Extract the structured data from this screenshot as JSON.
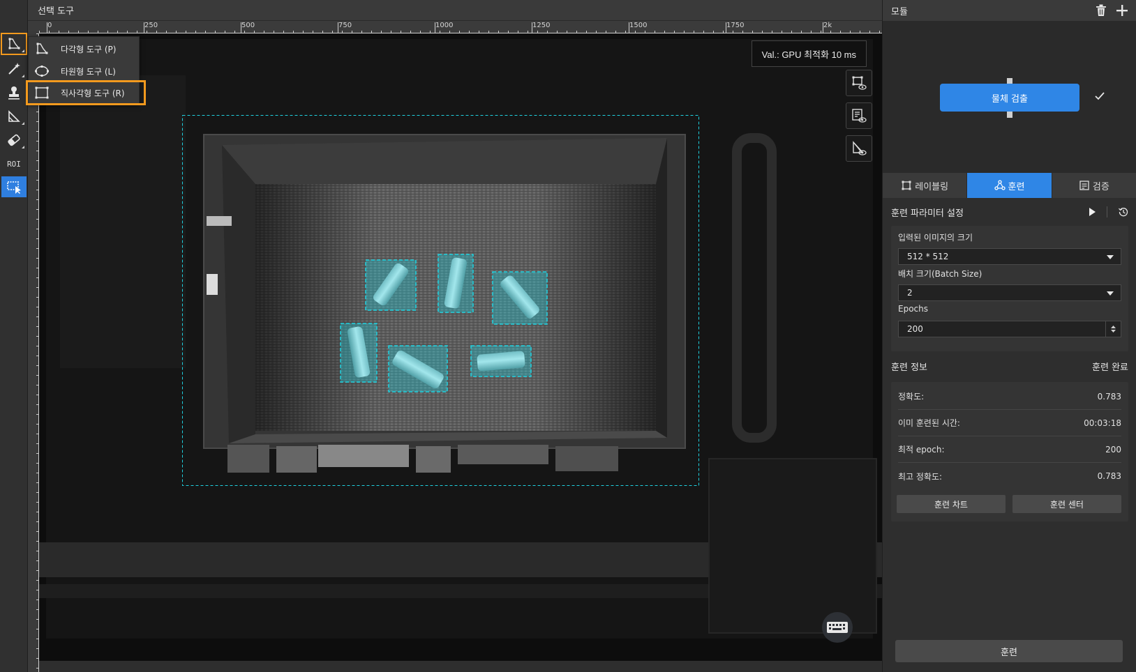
{
  "title_bar": {
    "title": "선택 도구"
  },
  "ruler": {
    "ticks": [
      "0",
      "250",
      "500",
      "750",
      "1000",
      "1250",
      "1500",
      "1750",
      "2k"
    ]
  },
  "toolbar": {
    "tools": [
      {
        "name": "polygon-tool",
        "icon": "polygon-icon",
        "highlighted": true
      },
      {
        "name": "magic-wand-tool",
        "icon": "magic-wand-icon"
      },
      {
        "name": "stamp-tool",
        "icon": "stamp-icon"
      },
      {
        "name": "polygon-eraser-tool",
        "icon": "polygon-corner-icon"
      },
      {
        "name": "eraser-tool",
        "icon": "eraser-icon"
      },
      {
        "name": "roi-tool",
        "icon": "roi-icon",
        "label": "ROI"
      },
      {
        "name": "select-tool",
        "icon": "select-rect-icon",
        "active": true
      }
    ]
  },
  "flyout": {
    "items": [
      {
        "label": "다각형 도구 (P)",
        "icon": "polygon-icon"
      },
      {
        "label": "타원형 도구 (L)",
        "icon": "ellipse-icon"
      },
      {
        "label": "직사각형 도구 (R)",
        "icon": "rectangle-icon",
        "highlighted": true
      }
    ]
  },
  "canvas": {
    "val_badge": "Val.:  GPU 최적화 10 ms",
    "view_buttons": [
      "label-view-icon",
      "list-view-icon",
      "mask-view-icon"
    ],
    "keyboard_icon": "keyboard-icon"
  },
  "right_panel": {
    "module_header": {
      "title": "모듈",
      "icons": [
        "trash-icon",
        "plus-icon"
      ]
    },
    "module_node": {
      "label": "물체 검출",
      "status_icon": "check-icon"
    },
    "tabs": [
      {
        "label": "레이블링",
        "icon": "labeling-icon"
      },
      {
        "label": "훈련",
        "icon": "train-icon",
        "active": true
      },
      {
        "label": "검증",
        "icon": "validate-icon"
      }
    ],
    "params": {
      "title": "훈련 파라미터 설정",
      "fields": {
        "input_size": {
          "label": "입력된 이미지의 크기",
          "value": "512 * 512"
        },
        "batch_size": {
          "label": "배치 크기(Batch Size)",
          "value": "2"
        },
        "epochs": {
          "label": "Epochs",
          "value": "200"
        }
      }
    },
    "info": {
      "title": "훈련 정보",
      "status": "훈련 완료",
      "rows": [
        {
          "label": "정확도:",
          "value": "0.783"
        },
        {
          "label": "이미 훈련된 시간:",
          "value": "00:03:18"
        },
        {
          "label": "최적 epoch:",
          "value": "200"
        },
        {
          "label": "최고 정확도:",
          "value": "0.783"
        }
      ],
      "buttons": {
        "chart": "훈련 차트",
        "center": "훈련 센터"
      }
    },
    "train_button": "훈련"
  },
  "colors": {
    "accent": "#2f86e6",
    "highlight": "#f39a1e",
    "label_box": "#1fd1e0"
  }
}
